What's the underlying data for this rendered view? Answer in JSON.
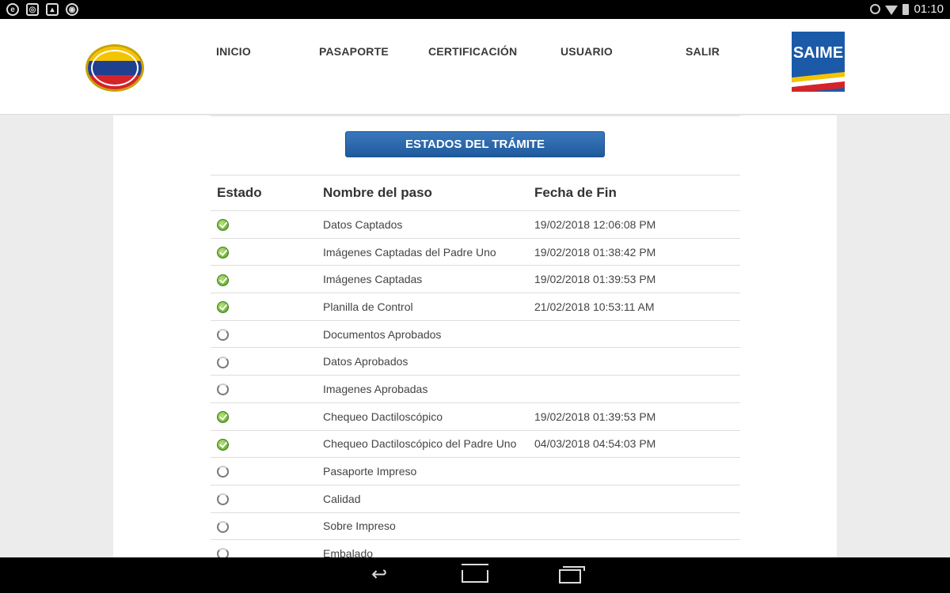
{
  "statusbar": {
    "left_icons": [
      "e-browser-icon",
      "instagram-icon",
      "gallery-icon",
      "chrome-icon"
    ],
    "time": "01:10"
  },
  "header": {
    "nav": [
      "INICIO",
      "PASAPORTE",
      "CERTIFICACIÓN",
      "USUARIO",
      "SALIR"
    ],
    "brand": "SAIME",
    "seal_text": "Ministerio del Poder Popular para Relaciones Interiores, Justicia y Paz"
  },
  "main": {
    "button_label": "ESTADOS DEL TRÁMITE",
    "columns": [
      "Estado",
      "Nombre del paso",
      "Fecha de Fin"
    ],
    "rows": [
      {
        "status": "done",
        "name": "Datos Captados",
        "date": "19/02/2018 12:06:08 PM"
      },
      {
        "status": "done",
        "name": "Imágenes Captadas del Padre Uno",
        "date": "19/02/2018 01:38:42 PM"
      },
      {
        "status": "done",
        "name": "Imágenes Captadas",
        "date": "19/02/2018 01:39:53 PM"
      },
      {
        "status": "done",
        "name": "Planilla de Control",
        "date": "21/02/2018 10:53:11 AM"
      },
      {
        "status": "pending",
        "name": "Documentos Aprobados",
        "date": ""
      },
      {
        "status": "pending",
        "name": "Datos Aprobados",
        "date": ""
      },
      {
        "status": "pending",
        "name": "Imagenes Aprobadas",
        "date": ""
      },
      {
        "status": "done",
        "name": "Chequeo Dactiloscópico",
        "date": "19/02/2018 01:39:53 PM"
      },
      {
        "status": "done",
        "name": "Chequeo Dactiloscópico del Padre Uno",
        "date": "04/03/2018 04:54:03 PM"
      },
      {
        "status": "pending",
        "name": "Pasaporte Impreso",
        "date": ""
      },
      {
        "status": "pending",
        "name": "Calidad",
        "date": ""
      },
      {
        "status": "pending",
        "name": "Sobre Impreso",
        "date": ""
      },
      {
        "status": "pending",
        "name": "Embalado",
        "date": ""
      }
    ]
  },
  "colors": {
    "accent": "#1f5a9c",
    "done": "#4f9d1b",
    "brand": "#1b5aa8"
  }
}
